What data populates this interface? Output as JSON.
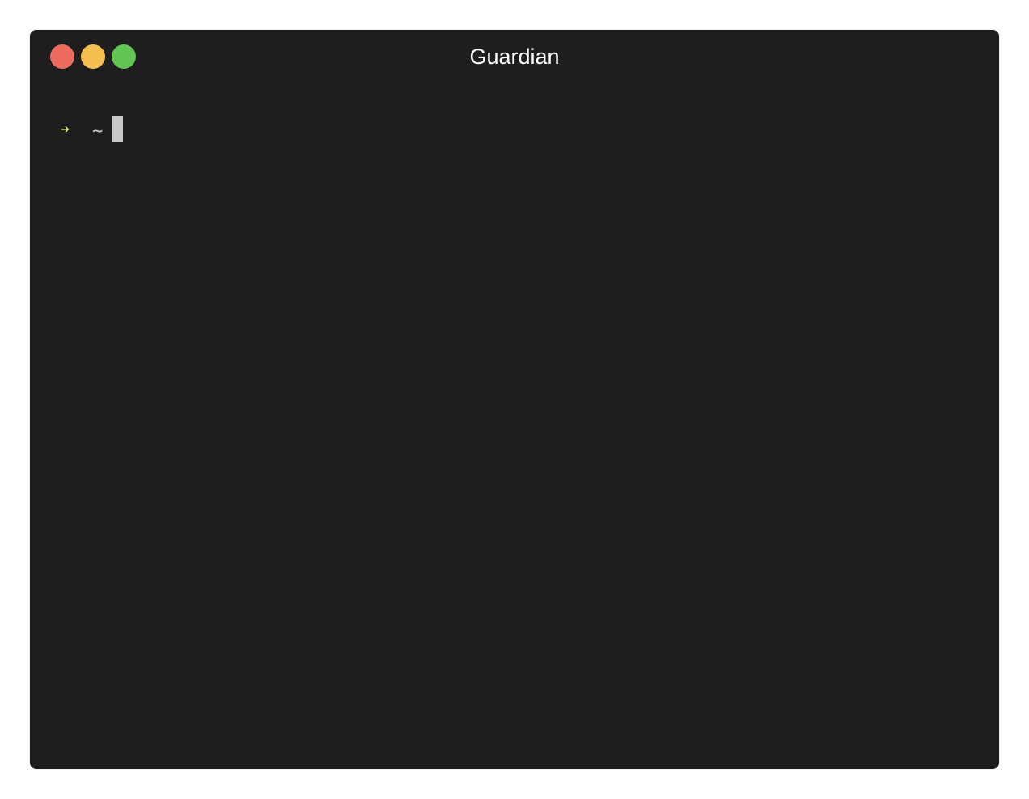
{
  "window": {
    "title": "Guardian"
  },
  "terminal": {
    "prompt_symbol": "➜",
    "current_dir": "~",
    "input": ""
  },
  "colors": {
    "background": "#1e1e1e",
    "prompt_arrow": "#d2e36a",
    "text": "#c9c9c9",
    "close": "#ed6a5e",
    "minimize": "#f5bf4f",
    "maximize": "#61c554"
  }
}
